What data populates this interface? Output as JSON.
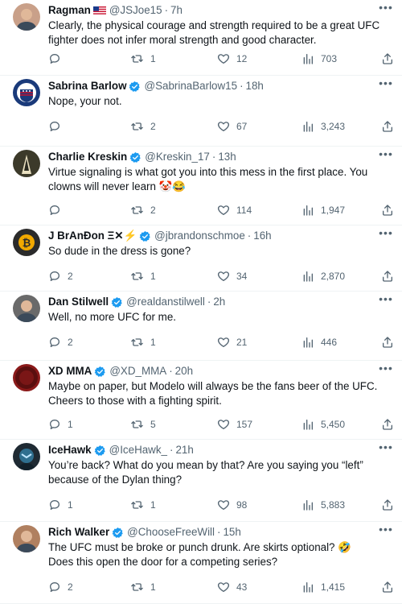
{
  "tweets": [
    {
      "name": "Ragman",
      "extra": "flag",
      "verified": false,
      "handle": "@JSJoe15",
      "time": "7h",
      "text": "Clearly, the physical courage and strength required to be a great UFC fighter does not infer moral strength and good character.",
      "reply": "",
      "retweets": "1",
      "likes": "12",
      "views": "703",
      "avatar_color": "#c9a089"
    },
    {
      "name": "Sabrina Barlow",
      "extra": "",
      "verified": true,
      "handle": "@SabrinaBarlow15",
      "time": "18h",
      "text": "Nope, your not.",
      "reply": "",
      "retweets": "2",
      "likes": "67",
      "views": "3,243",
      "avatar_color": "#1a3a7a"
    },
    {
      "name": "Charlie Kreskin",
      "extra": "",
      "verified": true,
      "handle": "@Kreskin_17",
      "time": "13h",
      "text": "Virtue signaling is what got you into this mess in the first place. You clowns will never learn 🤡😂",
      "reply": "",
      "retweets": "2",
      "likes": "114",
      "views": "1,947",
      "avatar_color": "#3c3a2a"
    },
    {
      "name": "J BrAnĐon Ξ✕⚡",
      "extra": "",
      "verified": true,
      "handle": "@jbrandonschmoe",
      "time": "16h",
      "text": "So dude in the dress is gone?",
      "reply": "2",
      "retweets": "1",
      "likes": "34",
      "views": "2,870",
      "avatar_color": "#2b2b2b"
    },
    {
      "name": "Dan Stilwell",
      "extra": "",
      "verified": true,
      "handle": "@realdanstilwell",
      "time": "2h",
      "text": "Well, no more UFC for me.",
      "reply": "2",
      "retweets": "1",
      "likes": "21",
      "views": "446",
      "avatar_color": "#6a6a6a"
    },
    {
      "name": "XD MMA",
      "extra": "",
      "verified": true,
      "handle": "@XD_MMA",
      "time": "20h",
      "text": "Maybe on paper, but Modelo will always be the fans beer of the UFC. Cheers to those with a fighting spirit.",
      "reply": "1",
      "retweets": "5",
      "likes": "157",
      "views": "5,450",
      "avatar_color": "#8b1a1a"
    },
    {
      "name": "IceHawk",
      "extra": "",
      "verified": true,
      "handle": "@IceHawk_",
      "time": "21h",
      "text": "You’re back? What do you mean by that? Are you saying you “left” because of the Dylan thing?",
      "reply": "1",
      "retweets": "1",
      "likes": "98",
      "views": "5,883",
      "avatar_color": "#1f2a33"
    },
    {
      "name": "Rich Walker",
      "extra": "",
      "verified": true,
      "handle": "@ChooseFreeWill",
      "time": "15h",
      "text": "The UFC must be broke or punch drunk. Are skirts optional? 🤣\nDoes this open the door for a competing series?",
      "reply": "2",
      "retweets": "1",
      "likes": "43",
      "views": "1,415",
      "avatar_color": "#b08060"
    }
  ]
}
